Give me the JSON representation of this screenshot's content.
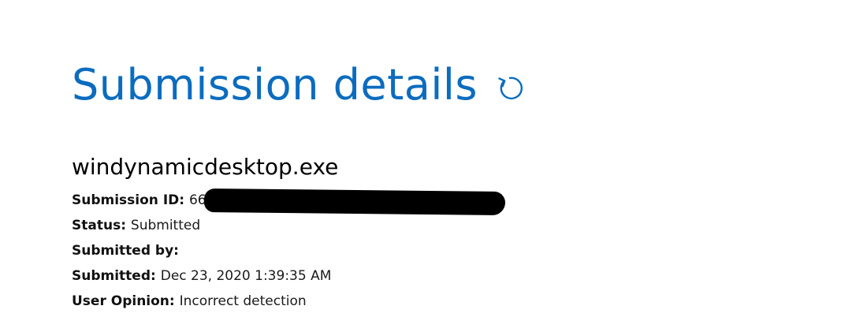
{
  "header": {
    "title": "Submission details",
    "refresh_icon": "refresh-icon"
  },
  "submission": {
    "file_name": "windynamicdesktop.exe",
    "fields": {
      "id": {
        "label": "Submission ID:",
        "value": "66"
      },
      "status": {
        "label": "Status:",
        "value": "Submitted"
      },
      "submitted_by": {
        "label": "Submitted by:",
        "value": ""
      },
      "submitted": {
        "label": "Submitted:",
        "value": "Dec 23, 2020 1:39:35 AM"
      },
      "user_opinion": {
        "label": "User Opinion:",
        "value": "Incorrect detection"
      }
    }
  },
  "colors": {
    "accent": "#0b6cbf",
    "redaction": "#000000"
  }
}
